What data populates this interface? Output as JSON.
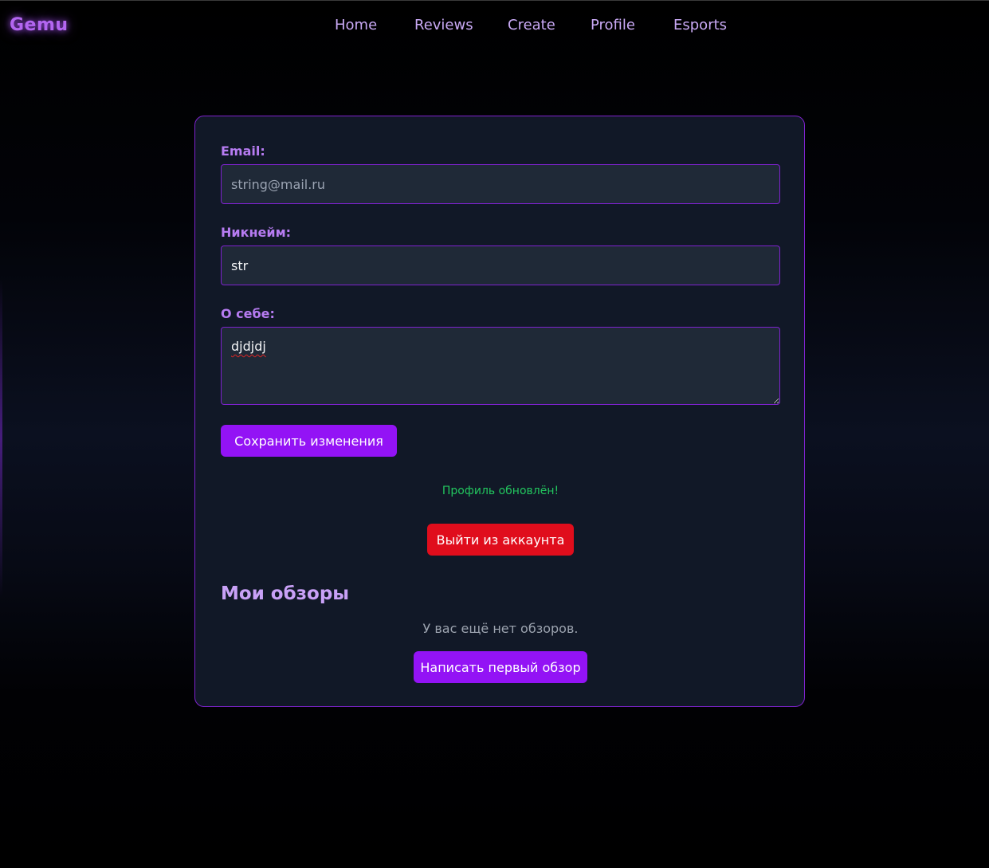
{
  "app": {
    "logo": "Gemu"
  },
  "nav": {
    "items": [
      {
        "label": "Home"
      },
      {
        "label": "Reviews"
      },
      {
        "label": "Create"
      },
      {
        "label": "Profile"
      },
      {
        "label": "Esports"
      }
    ]
  },
  "profile_form": {
    "email": {
      "label": "Email:",
      "placeholder": "string@mail.ru",
      "value": ""
    },
    "nickname": {
      "label": "Никнейм:",
      "value": "str"
    },
    "about": {
      "label": "О себе:",
      "value": "djdjdj"
    },
    "save_label": "Сохранить изменения",
    "status_message": "Профиль обновлён!",
    "logout_label": "Выйти из аккаунта"
  },
  "my_reviews": {
    "title": "Мои обзоры",
    "empty_message": "У вас ещё нет обзоров.",
    "write_first_label": "Написать первый обзор"
  },
  "colors": {
    "accent": "#9313f5",
    "danger": "#e00d1c",
    "success": "#22c55e",
    "card_bg": "#111827",
    "card_border": "#7e22ce",
    "field_bg": "#1f2937"
  }
}
